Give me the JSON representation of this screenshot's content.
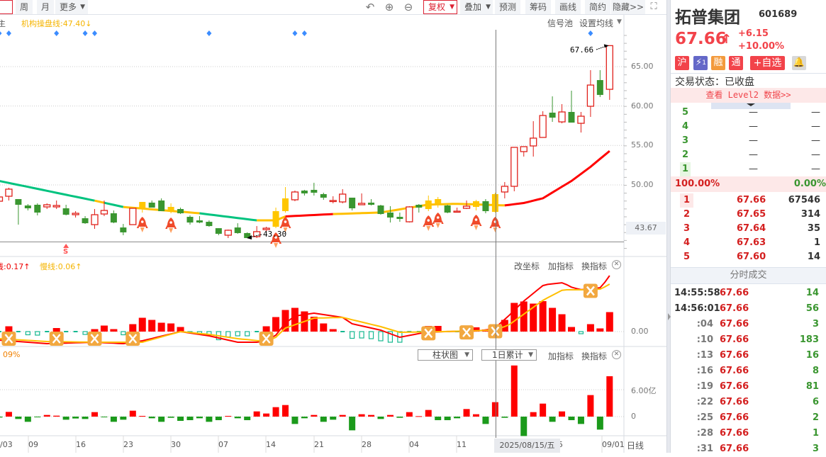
{
  "toolbar": {
    "left_buttons": [
      "周",
      "月",
      "更多"
    ],
    "fuquan": "复权",
    "diejia": "叠加",
    "right_buttons": [
      "预测",
      "筹码",
      "画线",
      "简约"
    ],
    "hide": "隐藏>>"
  },
  "main_legend": {
    "cut_label": "主",
    "institution_line": "机构操盘线:47.40",
    "institution_arrow": "↓",
    "signal_pool": "信号池",
    "set_ma": "设置均线"
  },
  "macd_legend": {
    "fast": "线:0.17↑",
    "slow": "慢线:0.06↑",
    "links": [
      "改坐标",
      "加指标",
      "换指标"
    ]
  },
  "volume_legend": {
    "cut_label": "09%",
    "chart_type": "柱状图",
    "period": "1日累计",
    "links": [
      "加指标",
      "换指标"
    ]
  },
  "axis": {
    "price_ticks": [
      "65.00",
      "60.00",
      "55.00",
      "50.00"
    ],
    "crosshair_price": "43.67",
    "macd_zero": "0.00",
    "vol_tick": "6.00亿",
    "vol_zero": "0",
    "dates": [
      "/03",
      "09",
      "16",
      "23",
      "30",
      "07",
      "14",
      "21",
      "28",
      "04",
      "11",
      "5",
      "09/01"
    ],
    "crosshair_date": "2025/08/15/五",
    "period_label": "日线"
  },
  "annotations": {
    "high": "67.66",
    "low": "43.30",
    "signal": "S"
  },
  "colors": {
    "up": "#e0201a",
    "down": "#3a9630",
    "special": "#ffc600",
    "ma_teal": "#00c37f",
    "ma_yellow": "#ffbf00",
    "ma_red": "#ff0000",
    "diamond": "#3b8cff"
  },
  "chart_data": {
    "type": "candlestick",
    "price_range": [
      42.5,
      68.5
    ],
    "candles": [
      [
        47.93,
        48.47,
        48.6,
        47.8,
        ""
      ],
      [
        48.56,
        49.46,
        49.64,
        48.02,
        ""
      ],
      [
        48.2,
        47.48,
        48.2,
        44.96,
        ""
      ],
      [
        47.39,
        47.03,
        47.57,
        46.76,
        ""
      ],
      [
        47.48,
        46.49,
        47.66,
        46.13,
        ""
      ],
      [
        47.21,
        47.48,
        47.66,
        46.94,
        ""
      ],
      [
        47.21,
        47.39,
        48.02,
        46.94,
        ""
      ],
      [
        47.03,
        46.22,
        47.48,
        46.13,
        ""
      ],
      [
        46.22,
        46.4,
        46.67,
        45.86,
        ""
      ],
      [
        45.77,
        45.14,
        46.04,
        45.05,
        ""
      ],
      [
        44.96,
        46.22,
        46.94,
        44.42,
        ""
      ],
      [
        46.31,
        46.76,
        48.02,
        46.04,
        ""
      ],
      [
        46.4,
        45.23,
        46.76,
        45.14,
        ""
      ],
      [
        44.6,
        43.98,
        45.05,
        43.62,
        ""
      ],
      [
        44.96,
        47.03,
        47.03,
        44.96,
        ""
      ],
      [
        47.12,
        47.84,
        47.84,
        46.49,
        "y"
      ],
      [
        47.75,
        47.12,
        48.02,
        47.12,
        ""
      ],
      [
        48.02,
        46.67,
        48.29,
        46.67,
        ""
      ],
      [
        46.76,
        47.21,
        47.66,
        46.4,
        "y"
      ],
      [
        46.94,
        46.4,
        47.12,
        46.31,
        ""
      ],
      [
        45.95,
        45.23,
        46.13,
        44.96,
        ""
      ],
      [
        45.5,
        45.23,
        46.04,
        45.14,
        ""
      ],
      [
        45.32,
        44.78,
        45.5,
        44.69,
        ""
      ],
      [
        44.51,
        43.8,
        44.51,
        43.62,
        ""
      ],
      [
        43.62,
        44.25,
        44.33,
        43.26,
        ""
      ],
      [
        44.6,
        43.89,
        45.14,
        43.8,
        ""
      ],
      [
        43.89,
        43.26,
        43.98,
        43.26,
        ""
      ],
      [
        43.44,
        44.07,
        44.78,
        43.26,
        ""
      ],
      [
        44.33,
        44.51,
        44.69,
        44.15,
        ""
      ],
      [
        44.69,
        46.67,
        47.12,
        44.51,
        "y"
      ],
      [
        46.67,
        48.29,
        49.73,
        46.49,
        "y"
      ],
      [
        48.11,
        49.1,
        49.28,
        47.93,
        ""
      ],
      [
        49.28,
        48.92,
        49.37,
        48.65,
        ""
      ],
      [
        49.37,
        49.01,
        50.27,
        48.65,
        ""
      ],
      [
        48.83,
        48.38,
        49.01,
        48.11,
        ""
      ],
      [
        47.93,
        48.02,
        48.56,
        47.66,
        ""
      ],
      [
        47.84,
        48.83,
        49.46,
        47.66,
        ""
      ],
      [
        48.38,
        47.03,
        48.38,
        46.76,
        ""
      ],
      [
        47.48,
        47.66,
        48.92,
        47.48,
        ""
      ],
      [
        47.75,
        47.48,
        48.2,
        47.39,
        ""
      ],
      [
        47.39,
        46.31,
        47.48,
        46.22,
        ""
      ],
      [
        46.49,
        45.86,
        47.3,
        45.23,
        ""
      ],
      [
        45.95,
        45.68,
        46.49,
        45.32,
        ""
      ],
      [
        45.32,
        47.21,
        47.3,
        45.23,
        ""
      ],
      [
        47.48,
        47.12,
        47.57,
        46.49,
        ""
      ],
      [
        46.94,
        48.02,
        48.65,
        46.67,
        "y"
      ],
      [
        47.66,
        48.2,
        48.47,
        47.12,
        "y"
      ],
      [
        47.39,
        46.49,
        47.48,
        46.4,
        ""
      ],
      [
        46.58,
        46.67,
        47.12,
        46.49,
        ""
      ],
      [
        47.03,
        47.3,
        48.02,
        46.94,
        ""
      ],
      [
        47.21,
        47.93,
        48.11,
        46.76,
        "y"
      ],
      [
        47.93,
        46.67,
        48.2,
        46.4,
        ""
      ],
      [
        46.58,
        48.83,
        49.01,
        46.49,
        "y"
      ],
      [
        49.1,
        49.82,
        50.36,
        48.29,
        ""
      ],
      [
        49.82,
        54.76,
        54.76,
        49.19,
        ""
      ],
      [
        54.22,
        54.85,
        54.85,
        53.59,
        ""
      ],
      [
        54.94,
        55.93,
        58.08,
        53.59,
        ""
      ],
      [
        56.02,
        58.8,
        59.34,
        56.02,
        ""
      ],
      [
        59.16,
        58.53,
        61.23,
        57.99,
        ""
      ],
      [
        57.99,
        59.25,
        60.24,
        57.81,
        ""
      ],
      [
        59.25,
        57.9,
        61.95,
        57.9,
        ""
      ],
      [
        57.81,
        58.71,
        59.25,
        56.64,
        ""
      ],
      [
        59.97,
        62.66,
        64.55,
        58.62,
        ""
      ],
      [
        63.29,
        61.41,
        64.55,
        61.14,
        ""
      ],
      [
        62.12,
        67.66,
        67.66,
        60.78,
        ""
      ]
    ],
    "ma_points": [
      [
        0,
        50.5
      ],
      [
        10,
        48.0
      ],
      [
        13,
        47.2
      ],
      [
        21,
        46.4
      ],
      [
        27,
        45.5
      ],
      [
        29,
        45.5
      ],
      [
        30,
        46.0
      ],
      [
        35,
        46.3
      ],
      [
        40,
        46.5
      ],
      [
        43,
        47.1
      ],
      [
        45,
        47.5
      ],
      [
        48,
        47.6
      ],
      [
        53,
        47.4
      ],
      [
        55,
        47.7
      ],
      [
        57,
        48.3
      ],
      [
        60,
        50.5
      ],
      [
        62,
        52.3
      ],
      [
        64,
        54.3
      ]
    ],
    "ma_segments": [
      [
        0,
        10,
        "ma_teal"
      ],
      [
        10,
        11,
        "ma_yellow"
      ],
      [
        11,
        13,
        "ma_teal"
      ],
      [
        13,
        21,
        "ma_yellow"
      ],
      [
        21,
        27,
        "ma_teal"
      ],
      [
        27,
        30,
        "ma_yellow"
      ],
      [
        30,
        35,
        "ma_red"
      ],
      [
        35,
        53,
        "ma_yellow"
      ],
      [
        53,
        64,
        "ma_red"
      ]
    ],
    "low_line": 43.67,
    "diamonds": [
      0,
      1,
      6,
      9,
      10,
      22,
      31,
      32,
      62
    ],
    "s_signal": [
      7
    ],
    "crosshair_index": 52,
    "macd": {
      "hist": [
        0,
        0.015,
        0,
        -0.009,
        -0.01,
        0,
        0.01,
        0,
        0,
        -0.008,
        0.007,
        0.017,
        0.007,
        -0.009,
        0.021,
        0.039,
        0.033,
        0.025,
        0.023,
        0.013,
        -0.002,
        -0.006,
        -0.01,
        -0.023,
        -0.015,
        -0.012,
        -0.012,
        0,
        0.015,
        0.041,
        0.061,
        0.067,
        0.057,
        0.042,
        0.023,
        0.007,
        0,
        -0.019,
        -0.018,
        -0.02,
        -0.026,
        -0.03,
        -0.03,
        0,
        0,
        0.016,
        0.016,
        0,
        0,
        0.006,
        0.012,
        0.006,
        0.021,
        0.033,
        0.081,
        0.085,
        0.079,
        0.086,
        0.067,
        0.049,
        0.013,
        -0.006,
        0.021,
        0.009,
        0.055
      ],
      "dif": [
        [
          0,
          -0.024
        ],
        [
          3,
          -0.03
        ],
        [
          5,
          -0.034
        ],
        [
          10,
          -0.03
        ],
        [
          13,
          -0.034
        ],
        [
          15,
          -0.026
        ],
        [
          19,
          0
        ],
        [
          22,
          -0.012
        ],
        [
          25,
          -0.03
        ],
        [
          27,
          -0.03
        ],
        [
          28,
          -0.026
        ],
        [
          29,
          -0.01
        ],
        [
          30,
          0.024
        ],
        [
          31,
          0.044
        ],
        [
          33,
          0.052
        ],
        [
          36,
          0.04
        ],
        [
          37,
          0.022
        ],
        [
          40,
          0.004
        ],
        [
          42,
          -0.016
        ],
        [
          44.7,
          -0.002
        ],
        [
          46.7,
          0
        ],
        [
          50.2,
          0.002
        ],
        [
          51.9,
          0.008
        ],
        [
          53.4,
          0.044
        ],
        [
          54.9,
          0.084
        ],
        [
          57.1,
          0.132
        ],
        [
          59.1,
          0.138
        ],
        [
          60.1,
          0.124
        ],
        [
          61.1,
          0.118
        ],
        [
          63.1,
          0.124
        ],
        [
          64,
          0.158
        ]
      ],
      "dea": [
        [
          0,
          -0.02
        ],
        [
          5,
          -0.028
        ],
        [
          10,
          -0.03
        ],
        [
          15,
          -0.03
        ],
        [
          19,
          0
        ],
        [
          22,
          -0.008
        ],
        [
          25,
          -0.02
        ],
        [
          28,
          -0.028
        ],
        [
          29,
          -0.016
        ],
        [
          30,
          0.01
        ],
        [
          33,
          0.038
        ],
        [
          36,
          0.04
        ],
        [
          40,
          0.014
        ],
        [
          42,
          -0.002
        ],
        [
          46.7,
          0
        ],
        [
          51.9,
          0.004
        ],
        [
          53.4,
          0.018
        ],
        [
          57.1,
          0.09
        ],
        [
          59.1,
          0.118
        ],
        [
          61.1,
          0.118
        ],
        [
          63.1,
          0.12
        ],
        [
          64,
          0.134
        ]
      ],
      "cross_marks": [
        1,
        6,
        10,
        14,
        28,
        45,
        49,
        52,
        62
      ]
    },
    "volume_yi": [
      -0.2,
      1.05,
      -0.53,
      -1.16,
      -0.1,
      0.37,
      0.21,
      -0.69,
      -0.42,
      -0.53,
      1.0,
      -0.1,
      -1.16,
      -0.69,
      1.32,
      0.16,
      -0.37,
      -1.16,
      -0.26,
      -0.95,
      -0.79,
      -0.37,
      -1.16,
      -0.79,
      0.16,
      -0.37,
      -0.79,
      1.16,
      0.69,
      2.11,
      2.58,
      -1.64,
      -0.37,
      0.37,
      -1.16,
      -0.69,
      0.37,
      -3.06,
      0.53,
      0.37,
      -0.53,
      0.37,
      -0.26,
      1.0,
      0.1,
      1.48,
      -0.79,
      -0.79,
      -0.37,
      1.69,
      0.53,
      -1.64,
      3.22,
      -0.26,
      11.4,
      -4.33,
      1.0,
      2.9,
      -1.16,
      1.16,
      -0.79,
      -1.64,
      4.8,
      -2.9,
      9.0
    ]
  },
  "quote": {
    "name": "拓普集团",
    "code": "601689",
    "price": "67.66",
    "arrow": "↑",
    "change": "+6.15",
    "change_pct": "+10.00%",
    "badges": [
      "沪",
      "1",
      "融",
      "通"
    ],
    "add_watch": "+自选",
    "status": "交易状态：已收盘",
    "level2": "查看 Level2 数据>>",
    "sell": [
      {
        "level": "5",
        "price": "—",
        "vol": "—"
      },
      {
        "level": "4",
        "price": "—",
        "vol": "—"
      },
      {
        "level": "3",
        "price": "—",
        "vol": "—"
      },
      {
        "level": "2",
        "price": "—",
        "vol": "—"
      },
      {
        "level": "1",
        "price": "—",
        "vol": "—"
      }
    ],
    "ratio_buy": "100.00%",
    "ratio_sell": "0.00%",
    "buy": [
      {
        "level": "1",
        "price": "67.66",
        "vol": "67546"
      },
      {
        "level": "2",
        "price": "67.65",
        "vol": "314"
      },
      {
        "level": "3",
        "price": "67.64",
        "vol": "35"
      },
      {
        "level": "4",
        "price": "67.63",
        "vol": "1"
      },
      {
        "level": "5",
        "price": "67.60",
        "vol": "14"
      }
    ],
    "trades_title": "分时成交",
    "trades": [
      {
        "time": "14:55:58",
        "price": "67.66",
        "vol": "14"
      },
      {
        "time": "14:56:01",
        "price": "67.66",
        "vol": "56"
      },
      {
        "time": ":04",
        "price": "67.66",
        "vol": "3"
      },
      {
        "time": ":10",
        "price": "67.66",
        "vol": "183"
      },
      {
        "time": ":13",
        "price": "67.66",
        "vol": "16"
      },
      {
        "time": ":16",
        "price": "67.66",
        "vol": "8"
      },
      {
        "time": ":19",
        "price": "67.66",
        "vol": "81"
      },
      {
        "time": ":22",
        "price": "67.66",
        "vol": "6"
      },
      {
        "time": ":25",
        "price": "67.66",
        "vol": "2"
      },
      {
        "time": ":28",
        "price": "67.66",
        "vol": "1"
      },
      {
        "time": ":31",
        "price": "67.66",
        "vol": "3"
      }
    ]
  }
}
